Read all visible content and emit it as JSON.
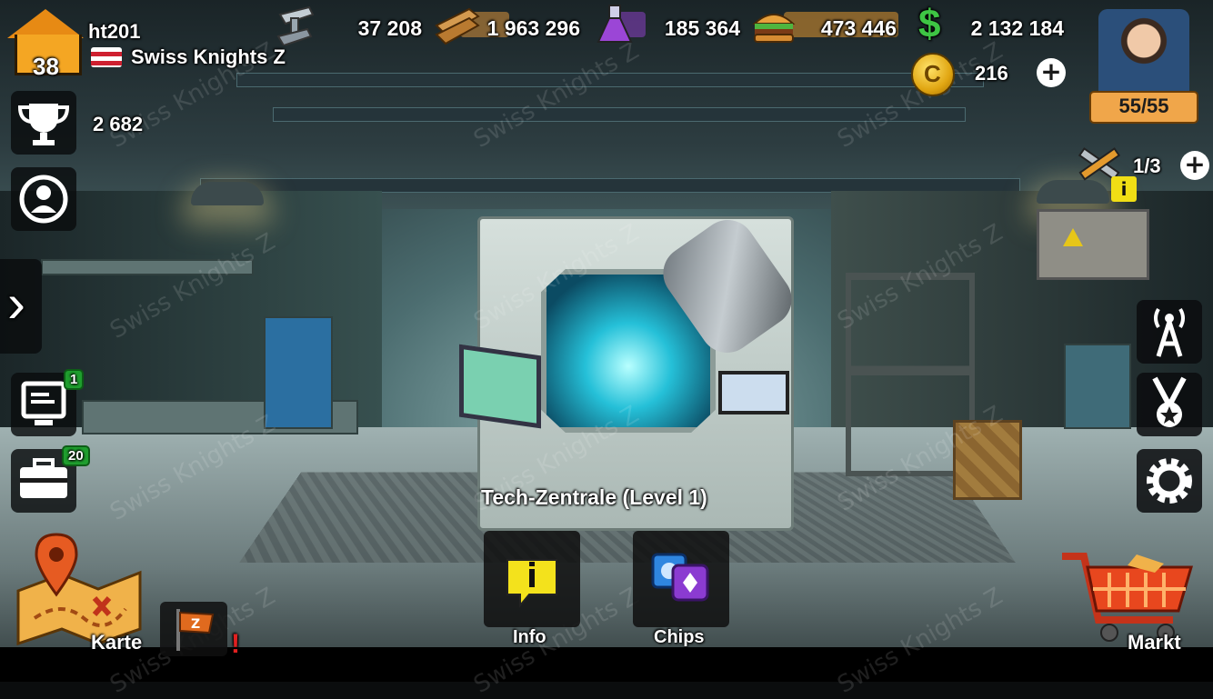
{
  "player": {
    "level": "38",
    "name": "ht201",
    "clan": "Swiss Knights Z",
    "trophies": "2 682"
  },
  "resources": [
    {
      "name": "steel",
      "icon": "steel-beam-icon",
      "value": "37 208",
      "color": "#9aa6b0"
    },
    {
      "name": "wood",
      "icon": "wood-planks-icon",
      "value": "1 963 296",
      "color": "#c98a3b"
    },
    {
      "name": "oil",
      "icon": "flask-icon",
      "value": "185 364",
      "color": "#8b3fc4"
    },
    {
      "name": "food",
      "icon": "burger-icon",
      "value": "473 446",
      "color": "#e0952f"
    },
    {
      "name": "cash",
      "icon": "dollar-icon",
      "value": "2 132 184",
      "color": "#33b43a"
    }
  ],
  "coins": {
    "value": "216",
    "add_label": "+"
  },
  "energy": "55/55",
  "builders": {
    "value": "1/3",
    "add_label": "+",
    "info_label": "i"
  },
  "left_menu": {
    "news_badge": "1",
    "inventory_badge": "20",
    "expand_label": "›"
  },
  "building": {
    "title": "Tech-Zentrale (Level 1)"
  },
  "actions": [
    {
      "label": "Info",
      "icon": "info-speech-icon"
    },
    {
      "label": "Chips",
      "icon": "chips-icon"
    }
  ],
  "nav": {
    "map_label": "Karte",
    "market_label": "Markt",
    "alert": "!"
  },
  "watermark": "Swiss Knights Z"
}
